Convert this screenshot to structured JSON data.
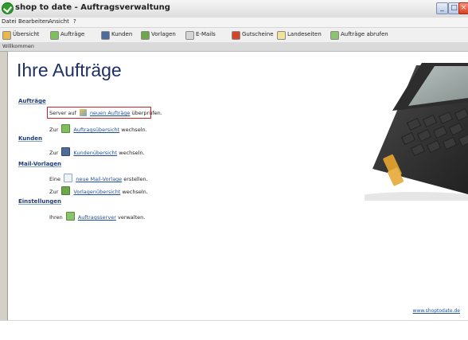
{
  "window": {
    "title": "shop to date - Auftragsverwaltung"
  },
  "menu": [
    "Datei",
    "Bearbeiten",
    "Ansicht",
    "?"
  ],
  "toolbar": [
    {
      "label": "Übersicht",
      "icon": "home-icon",
      "color": "#e8b84a"
    },
    {
      "label": "Aufträge",
      "icon": "orders-icon",
      "color": "#7fbf5c"
    },
    {
      "label": "Kunden",
      "icon": "customers-icon",
      "color": "#4f6b9b"
    },
    {
      "label": "Vorlagen",
      "icon": "templates-icon",
      "color": "#6ca84a"
    },
    {
      "label": "E-Mails",
      "icon": "mail-icon",
      "color": "#d5d5d5"
    },
    {
      "label": "Gutscheine",
      "icon": "voucher-icon",
      "color": "#d2452a"
    },
    {
      "label": "Landeseiten",
      "icon": "folder-icon",
      "color": "#f3e19a"
    },
    {
      "label": "Aufträge abrufen",
      "icon": "fetch-orders-icon",
      "color": "#8cc36e"
    }
  ],
  "tabs": [
    "Willkommen"
  ],
  "main": {
    "heading": "Ihre Aufträge",
    "sections": [
      {
        "title": "Aufträge",
        "rows": [
          {
            "prefix": "Server auf",
            "icon": "refresh-icon",
            "link": "neuen Aufträge",
            "suffix": "überprüfen."
          },
          {
            "prefix": "Zur",
            "icon": "overview-icon",
            "link": "Auftragsübersicht",
            "suffix": "wechseln."
          }
        ]
      },
      {
        "title": "Kunden",
        "rows": [
          {
            "prefix": "Zur",
            "icon": "customer-overview-icon",
            "link": "Kundenübersicht",
            "suffix": "wechseln."
          }
        ]
      },
      {
        "title": "Mail-Vorlagen",
        "rows": [
          {
            "prefix": "Eine",
            "icon": "new-template-icon",
            "link": "neue Mail-Vorlage",
            "suffix": "erstellen."
          },
          {
            "prefix": "Zur",
            "icon": "template-overview-icon",
            "link": "Vorlagenübersicht",
            "suffix": "wechseln."
          }
        ]
      },
      {
        "title": "Einstellungen",
        "rows": [
          {
            "prefix": "Ihren",
            "icon": "server-icon",
            "link": "Auftragsserver",
            "suffix": "verwalten."
          }
        ]
      }
    ]
  },
  "footer": {
    "site": "www.shoptodate.de"
  },
  "colors": {
    "accent": "#1f4f9b",
    "heading": "#1f2f63",
    "highlight": "#c82424"
  }
}
